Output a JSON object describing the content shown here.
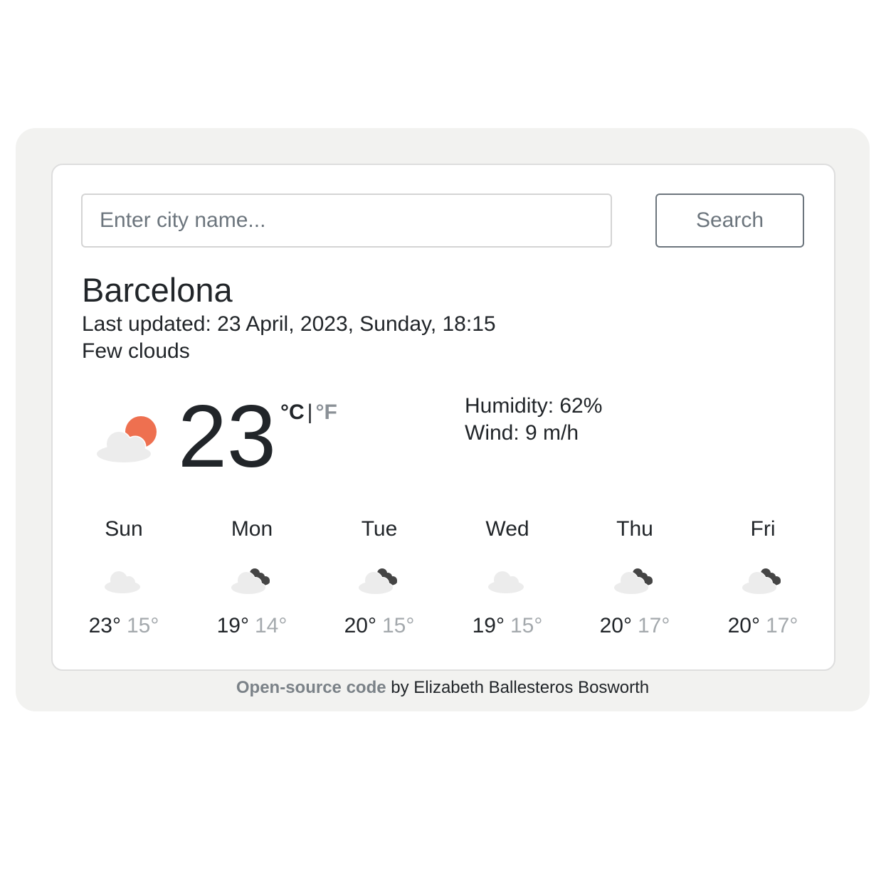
{
  "search": {
    "placeholder": "Enter city name...",
    "value": "",
    "button_label": "Search"
  },
  "current": {
    "city": "Barcelona",
    "last_updated": "Last updated: 23 April, 2023, Sunday, 18:15",
    "description": "Few clouds",
    "icon": "few-clouds-day-icon",
    "temperature": "23",
    "unit_celsius": "°C",
    "unit_separator": "|",
    "unit_fahrenheit": "°F",
    "humidity": "Humidity: 62%",
    "wind": "Wind: 9 m/h"
  },
  "forecast": [
    {
      "day": "Sun",
      "icon": "cloud-icon",
      "max": "23°",
      "min": "15°"
    },
    {
      "day": "Mon",
      "icon": "broken-clouds-icon",
      "max": "19°",
      "min": "14°"
    },
    {
      "day": "Tue",
      "icon": "broken-clouds-icon",
      "max": "20°",
      "min": "15°"
    },
    {
      "day": "Wed",
      "icon": "cloud-icon",
      "max": "19°",
      "min": "15°"
    },
    {
      "day": "Thu",
      "icon": "broken-clouds-icon",
      "max": "20°",
      "min": "17°"
    },
    {
      "day": "Fri",
      "icon": "broken-clouds-icon",
      "max": "20°",
      "min": "17°"
    }
  ],
  "footer": {
    "link_text": "Open-source code",
    "credit_text": " by Elizabeth Ballesteros Bosworth"
  },
  "colors": {
    "sun": "#ee7050",
    "cloud_light": "#ececec",
    "cloud_dark": "#454545",
    "min_temp": "#a4a9ad",
    "panel_bg": "#f2f2f0"
  }
}
